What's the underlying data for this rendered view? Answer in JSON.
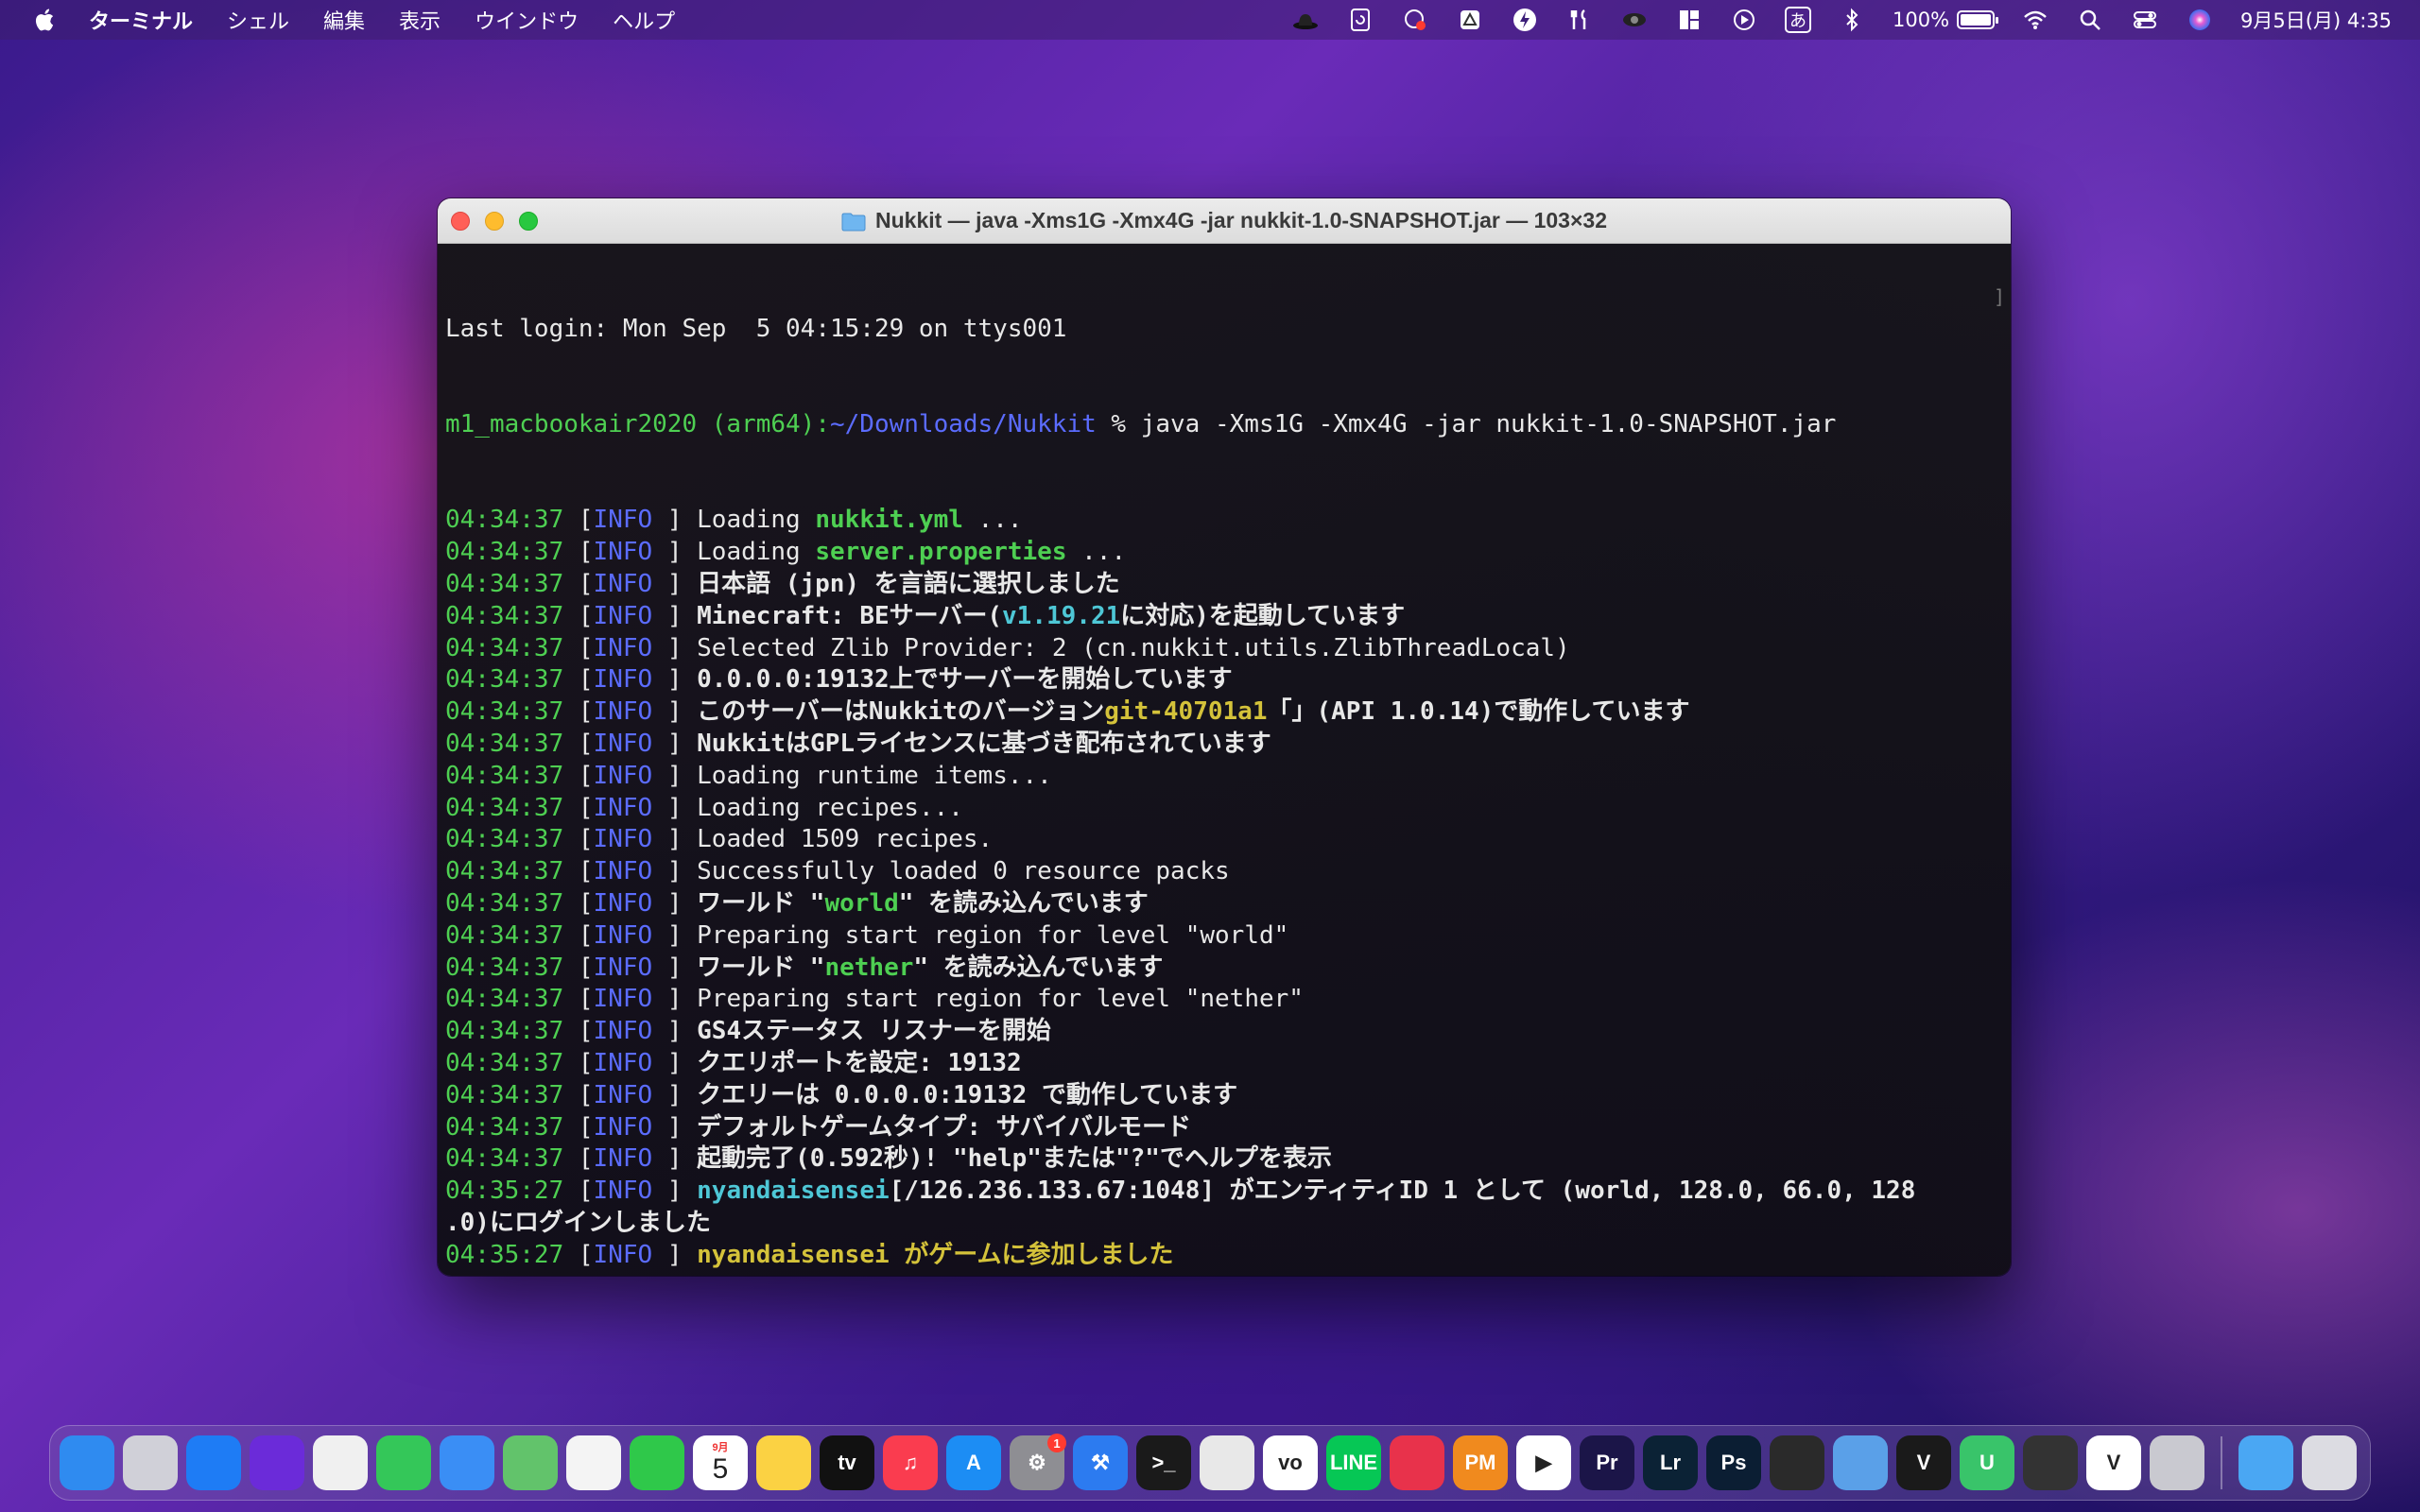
{
  "menubar": {
    "app_name": "ターミナル",
    "items": [
      "シェル",
      "編集",
      "表示",
      "ウインドウ",
      "ヘルプ"
    ],
    "battery_percent": "100%",
    "battery_level": 1.0,
    "clock": "9月5日(月) 4:35",
    "status_icons": [
      "hat-icon",
      "time-machine-icon",
      "screen-recorder-icon",
      "drive-icon",
      "bolt-icon",
      "tools-icon",
      "eye-icon",
      "layout-icon",
      "play-icon"
    ],
    "input_method": "あ"
  },
  "window": {
    "title": "Nukkit — java -Xms1G -Xmx4G -jar nukkit-1.0-SNAPSHOT.jar — 103×32"
  },
  "terminal": {
    "last_login": "Last login: Mon Sep  5 04:15:29 on ttys001",
    "prompt": {
      "host": "m1_macbookair2020 (arm64)",
      "sep": ":",
      "path": "~/Downloads/Nukkit",
      "command": " % java -Xms1G -Xmx4G -jar nukkit-1.0-SNAPSHOT.jar"
    },
    "log_level": "INFO",
    "lines": [
      {
        "ts": "04:34:37",
        "parts": [
          {
            "t": "Loading "
          },
          {
            "t": "nukkit.yml",
            "c": "g"
          },
          {
            "t": " ..."
          }
        ]
      },
      {
        "ts": "04:34:37",
        "parts": [
          {
            "t": "Loading "
          },
          {
            "t": "server.properties",
            "c": "g"
          },
          {
            "t": " ..."
          }
        ]
      },
      {
        "ts": "04:34:37",
        "parts": [
          {
            "t": "日本語 (jpn) を言語に選択しました",
            "c": "bold"
          }
        ]
      },
      {
        "ts": "04:34:37",
        "parts": [
          {
            "t": "Minecraft: BEサーバー(",
            "c": "bold"
          },
          {
            "t": "v1.19.21",
            "c": "c"
          },
          {
            "t": "に対応)を起動しています",
            "c": "bold"
          }
        ]
      },
      {
        "ts": "04:34:37",
        "parts": [
          {
            "t": "Selected Zlib Provider: 2 (cn.nukkit.utils.ZlibThreadLocal)"
          }
        ]
      },
      {
        "ts": "04:34:37",
        "parts": [
          {
            "t": "0.0.0.0:19132上でサーバーを開始しています",
            "c": "bold"
          }
        ]
      },
      {
        "ts": "04:34:37",
        "parts": [
          {
            "t": "このサーバーはNukkitのバージョン",
            "c": "bold"
          },
          {
            "t": "git-40701a1",
            "c": "y"
          },
          {
            "t": "「」(API 1.0.14)で動作しています",
            "c": "bold"
          }
        ]
      },
      {
        "ts": "04:34:37",
        "parts": [
          {
            "t": "NukkitはGPLライセンスに基づき配布されています",
            "c": "bold"
          }
        ]
      },
      {
        "ts": "04:34:37",
        "parts": [
          {
            "t": "Loading runtime items..."
          }
        ]
      },
      {
        "ts": "04:34:37",
        "parts": [
          {
            "t": "Loading recipes..."
          }
        ]
      },
      {
        "ts": "04:34:37",
        "parts": [
          {
            "t": "Loaded 1509 recipes."
          }
        ]
      },
      {
        "ts": "04:34:37",
        "parts": [
          {
            "t": "Successfully loaded 0 resource packs"
          }
        ]
      },
      {
        "ts": "04:34:37",
        "parts": [
          {
            "t": "ワールド \"",
            "c": "bold"
          },
          {
            "t": "world",
            "c": "g"
          },
          {
            "t": "\" を読み込んでいます",
            "c": "bold"
          }
        ]
      },
      {
        "ts": "04:34:37",
        "parts": [
          {
            "t": "Preparing start region for level \"world\""
          }
        ]
      },
      {
        "ts": "04:34:37",
        "parts": [
          {
            "t": "ワールド \"",
            "c": "bold"
          },
          {
            "t": "nether",
            "c": "g"
          },
          {
            "t": "\" を読み込んでいます",
            "c": "bold"
          }
        ]
      },
      {
        "ts": "04:34:37",
        "parts": [
          {
            "t": "Preparing start region for level \"nether\""
          }
        ]
      },
      {
        "ts": "04:34:37",
        "parts": [
          {
            "t": "GS4ステータス リスナーを開始",
            "c": "bold"
          }
        ]
      },
      {
        "ts": "04:34:37",
        "parts": [
          {
            "t": "クエリポートを設定: 19132",
            "c": "bold"
          }
        ]
      },
      {
        "ts": "04:34:37",
        "parts": [
          {
            "t": "クエリーは 0.0.0.0:19132 で動作しています",
            "c": "bold"
          }
        ]
      },
      {
        "ts": "04:34:37",
        "parts": [
          {
            "t": "デフォルトゲームタイプ: サバイバルモード",
            "c": "bold"
          }
        ]
      },
      {
        "ts": "04:34:37",
        "parts": [
          {
            "t": "起動完了(0.592秒)! \"help\"または\"?\"でヘルプを表示",
            "c": "bold"
          }
        ]
      },
      {
        "ts": "04:35:27",
        "parts": [
          {
            "t": "nyandaisensei",
            "c": "c"
          },
          {
            "t": "[/126.236.133.67:1048] がエンティティID 1 として (world, 128.0, 66.0, 128",
            "c": "bold"
          }
        ],
        "cont": ".0)にログインしました"
      },
      {
        "ts": "04:35:27",
        "parts": [
          {
            "t": "nyandaisensei がゲームに参加しました",
            "c": "y"
          }
        ]
      }
    ],
    "input_prompt": ">"
  },
  "dock": {
    "calendar_month": "9月",
    "calendar_day": "5",
    "settings_badge": "1",
    "apps": [
      {
        "name": "finder",
        "label": "",
        "bg": "#2f8bf0"
      },
      {
        "name": "launchpad",
        "label": "",
        "bg": "#d0d0d8"
      },
      {
        "name": "safari",
        "label": "",
        "bg": "#1e7cf5"
      },
      {
        "name": "firefox",
        "label": "",
        "bg": "#6b2bd9"
      },
      {
        "name": "chrome",
        "label": "",
        "bg": "#f0f0f0"
      },
      {
        "name": "messages",
        "label": "",
        "bg": "#34c759"
      },
      {
        "name": "mail",
        "label": "",
        "bg": "#3a8ef5"
      },
      {
        "name": "maps",
        "label": "",
        "bg": "#62c36b"
      },
      {
        "name": "photos",
        "label": "",
        "bg": "#f4f4f4"
      },
      {
        "name": "facetime",
        "label": "",
        "bg": "#2fc84a"
      },
      {
        "name": "calendar",
        "label": "",
        "bg": "#ffffff"
      },
      {
        "name": "notes",
        "label": "",
        "bg": "#fbd243"
      },
      {
        "name": "apple-tv",
        "label": "tv",
        "bg": "#111111"
      },
      {
        "name": "music",
        "label": "♫",
        "bg": "#fa3c4f"
      },
      {
        "name": "app-store",
        "label": "A",
        "bg": "#1c8df4"
      },
      {
        "name": "system-preferences",
        "label": "⚙",
        "bg": "#8e8e93"
      },
      {
        "name": "xcode",
        "label": "⚒",
        "bg": "#2c7bf0"
      },
      {
        "name": "terminal",
        "label": ">_",
        "bg": "#1a1a1a"
      },
      {
        "name": "climber-app",
        "label": "",
        "bg": "#e8e8e8"
      },
      {
        "name": "vo-app",
        "label": "vo",
        "bg": "#ffffff"
      },
      {
        "name": "line",
        "label": "LINE",
        "bg": "#06c755"
      },
      {
        "name": "creative-cloud",
        "label": "",
        "bg": "#e8324b"
      },
      {
        "name": "pm",
        "label": "PM",
        "bg": "#f08a1e"
      },
      {
        "name": "recorder",
        "label": "▶",
        "bg": "#ffffff"
      },
      {
        "name": "premiere",
        "label": "Pr",
        "bg": "#1b1548"
      },
      {
        "name": "lightroom",
        "label": "Lr",
        "bg": "#0b2235"
      },
      {
        "name": "photoshop",
        "label": "Ps",
        "bg": "#0b1e33"
      },
      {
        "name": "obs",
        "label": "",
        "bg": "#2a2a2a"
      },
      {
        "name": "screen-app",
        "label": "",
        "bg": "#5aa0e8"
      },
      {
        "name": "vectorworks",
        "label": "V",
        "bg": "#1a1a1a"
      },
      {
        "name": "u-app",
        "label": "U",
        "bg": "#39c46a"
      },
      {
        "name": "garageband",
        "label": "",
        "bg": "#333333"
      },
      {
        "name": "v-app",
        "label": "V",
        "bg": "#ffffff"
      },
      {
        "name": "disk-utility",
        "label": "",
        "bg": "#c9c9d0"
      },
      {
        "name": "downloads-folder",
        "label": "",
        "bg": "#4aa7f3"
      },
      {
        "name": "trash",
        "label": "",
        "bg": "#dcdce2"
      }
    ]
  }
}
